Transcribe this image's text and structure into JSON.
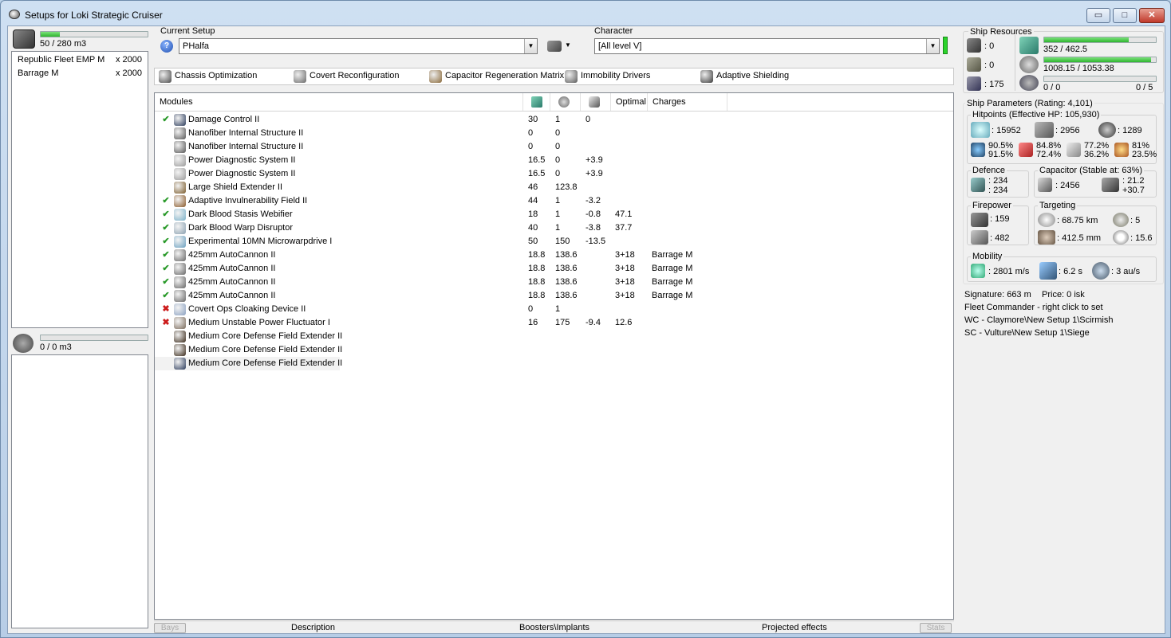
{
  "window": {
    "title": "Setups for Loki Strategic Cruiser",
    "min_glyph": "▭",
    "max_glyph": "□",
    "close_glyph": "✕"
  },
  "cargo": {
    "capacity_text": "50 / 280 m3",
    "fill": 0.18,
    "items": [
      {
        "name": "Republic Fleet EMP M",
        "qty": "x 2000"
      },
      {
        "name": "Barrage M",
        "qty": "x 2000"
      }
    ]
  },
  "drone_bay": {
    "capacity_text": "0 / 0 m3",
    "fill": 0
  },
  "current_setup": {
    "label": "Current Setup",
    "value": "PHalfa",
    "help_glyph": "?"
  },
  "character": {
    "label": "Character",
    "value": "[All level V]"
  },
  "subsystems": [
    {
      "name": "Chassis Optimization",
      "color": "#4a4a4a"
    },
    {
      "name": "Covert Reconfiguration",
      "color": "#6a6a6a"
    },
    {
      "name": "Capacitor Regeneration Matrix",
      "color": "#8a6a3a"
    },
    {
      "name": "Immobility Drivers",
      "color": "#5a5a5a"
    },
    {
      "name": "Adaptive Shielding",
      "color": "#3a3a3a"
    }
  ],
  "modules_table": {
    "headers": {
      "name": "Modules",
      "optimal": "Optimal",
      "charges": "Charges"
    },
    "rows": [
      {
        "status": "on",
        "name": "Damage Control II",
        "cpu": "30",
        "pg": "1",
        "cap": "0",
        "optimal": "",
        "charges": "",
        "color": "#2a3a5a"
      },
      {
        "status": "",
        "name": "Nanofiber Internal Structure II",
        "cpu": "0",
        "pg": "0",
        "cap": "",
        "optimal": "",
        "charges": "",
        "color": "#555555"
      },
      {
        "status": "",
        "name": "Nanofiber Internal Structure II",
        "cpu": "0",
        "pg": "0",
        "cap": "",
        "optimal": "",
        "charges": "",
        "color": "#555555"
      },
      {
        "status": "",
        "name": "Power Diagnostic System II",
        "cpu": "16.5",
        "pg": "0",
        "cap": "+3.9",
        "optimal": "",
        "charges": "",
        "color": "#9a9a9a"
      },
      {
        "status": "",
        "name": "Power Diagnostic System II",
        "cpu": "16.5",
        "pg": "0",
        "cap": "+3.9",
        "optimal": "",
        "charges": "",
        "color": "#9a9a9a"
      },
      {
        "status": "",
        "name": "Large Shield Extender II",
        "cpu": "46",
        "pg": "123.8",
        "cap": "",
        "optimal": "",
        "charges": "",
        "color": "#7a5a2a"
      },
      {
        "status": "on",
        "name": "Adaptive Invulnerability Field II",
        "cpu": "44",
        "pg": "1",
        "cap": "-3.2",
        "optimal": "",
        "charges": "",
        "color": "#8a5a2a"
      },
      {
        "status": "on",
        "name": "Dark Blood Stasis Webifier",
        "cpu": "18",
        "pg": "1",
        "cap": "-0.8",
        "optimal": "47.1",
        "charges": "",
        "color": "#7ab0c8"
      },
      {
        "status": "on",
        "name": "Dark Blood Warp Disruptor",
        "cpu": "40",
        "pg": "1",
        "cap": "-3.8",
        "optimal": "37.7",
        "charges": "",
        "color": "#8aa0b0"
      },
      {
        "status": "on",
        "name": "Experimental 10MN Microwarpdrive I",
        "cpu": "50",
        "pg": "150",
        "cap": "-13.5",
        "optimal": "",
        "charges": "",
        "color": "#6aa0c0"
      },
      {
        "status": "on",
        "name": "425mm AutoCannon II",
        "cpu": "18.8",
        "pg": "138.6",
        "cap": "",
        "optimal": "3+18",
        "charges": "Barrage M",
        "color": "#666666"
      },
      {
        "status": "on",
        "name": "425mm AutoCannon II",
        "cpu": "18.8",
        "pg": "138.6",
        "cap": "",
        "optimal": "3+18",
        "charges": "Barrage M",
        "color": "#666666"
      },
      {
        "status": "on",
        "name": "425mm AutoCannon II",
        "cpu": "18.8",
        "pg": "138.6",
        "cap": "",
        "optimal": "3+18",
        "charges": "Barrage M",
        "color": "#666666"
      },
      {
        "status": "on",
        "name": "425mm AutoCannon II",
        "cpu": "18.8",
        "pg": "138.6",
        "cap": "",
        "optimal": "3+18",
        "charges": "Barrage M",
        "color": "#666666"
      },
      {
        "status": "off",
        "name": "Covert Ops Cloaking Device II",
        "cpu": "0",
        "pg": "1",
        "cap": "",
        "optimal": "",
        "charges": "",
        "color": "#8aa0c0"
      },
      {
        "status": "off",
        "name": "Medium Unstable Power Fluctuator I",
        "cpu": "16",
        "pg": "175",
        "cap": "-9.4",
        "optimal": "12.6",
        "charges": "",
        "color": "#7a6a5a"
      },
      {
        "status": "",
        "name": "Medium Core Defense Field Extender II",
        "cpu": "",
        "pg": "",
        "cap": "",
        "optimal": "",
        "charges": "",
        "color": "#3a2a1a"
      },
      {
        "status": "",
        "name": "Medium Core Defense Field Extender II",
        "cpu": "",
        "pg": "",
        "cap": "",
        "optimal": "",
        "charges": "",
        "color": "#3a2a1a"
      },
      {
        "status": "",
        "name": "Medium Core Defense Field Extender II",
        "cpu": "",
        "pg": "",
        "cap": "",
        "optimal": "",
        "charges": "",
        "color": "#2a3a5a"
      }
    ]
  },
  "footer": {
    "bays": "Bays",
    "description": "Description",
    "boosters": "Boosters\\Implants",
    "projected": "Projected effects",
    "stats": "Stats"
  },
  "ship_resources": {
    "title": "Ship Resources",
    "turret_slots": ": 0",
    "launcher_slots": ": 0",
    "calibration": ": 175",
    "cpu_text": "352 / 462.5",
    "cpu_fill": 0.76,
    "pg_text": "1008.15 / 1053.38",
    "pg_fill": 0.957,
    "drone_bw_text": "0 / 0",
    "drone_count_text": "0 / 5",
    "drone_fill": 0
  },
  "ship_parameters": {
    "title": "Ship Parameters (Rating: 4,101)",
    "hitpoints": {
      "title": "Hitpoints (Effective HP: 105,930)",
      "shield": ": 15952",
      "armor": ": 2956",
      "structure": ": 1289",
      "em": [
        "90.5%",
        "91.5%"
      ],
      "thermal": [
        "84.8%",
        "72.4%"
      ],
      "kinetic": [
        "77.2%",
        "36.2%"
      ],
      "explosive": [
        "81%",
        "23.5%"
      ]
    },
    "defence": {
      "title": "Defence",
      "line1": ": 234",
      "line2": ": 234"
    },
    "capacitor": {
      "title": "Capacitor (Stable at: 63%)",
      "capacity": ": 2456",
      "line1": ": 21.2",
      "line2": "+30.7"
    },
    "firepower": {
      "title": "Firepower",
      "dps": ": 159",
      "volley": ": 482"
    },
    "targeting": {
      "title": "Targeting",
      "range": ": 68.75 km",
      "max_targets": ": 5",
      "scan_res": ": 412.5 mm",
      "sensor": ": 15.6"
    },
    "mobility": {
      "title": "Mobility",
      "speed": ": 2801 m/s",
      "align": ": 6.2 s",
      "warp": ": 3 au/s"
    }
  },
  "info": {
    "signature": "Signature: 663 m",
    "price": "Price: 0 isk",
    "fleet_commander": "Fleet Commander - right click to set",
    "wing_commander": "WC - Claymore\\New Setup 1\\Scirmish",
    "squad_commander": "SC - Vulture\\New Setup 1\\Siege"
  }
}
